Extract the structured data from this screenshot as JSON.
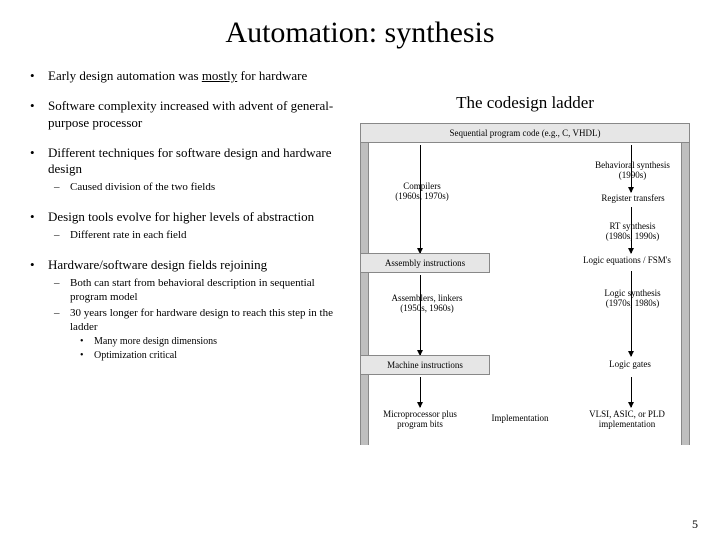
{
  "title": "Automation: synthesis",
  "bullets": {
    "b1": "Early design automation was ",
    "b1_u": "mostly",
    "b1_tail": " for hardware",
    "b2": "Software complexity increased with advent of general-purpose processor",
    "b3": "Different techniques for software design and hardware design",
    "b3_1": "Caused division of the two fields",
    "b4": "Design tools evolve for higher levels of abstraction",
    "b4_1": "Different rate in each field",
    "b5": "Hardware/software design fields rejoining",
    "b5_1": "Both can start from behavioral description in sequential program model",
    "b5_2": "30 years longer for hardware design to reach this step in the ladder",
    "b5_2_1": "Many more design dimensions",
    "b5_2_2": "Optimization critical"
  },
  "right_title": "The codesign ladder",
  "ladder": {
    "top": "Sequential program code (e.g., C, VHDL)",
    "left_compilers": "Compilers\n(1960s, 1970s)",
    "left_assemblers": "Assemblers, linkers\n(1950s, 1960s)",
    "rung_asm_instr": "Assembly instructions",
    "rung_mach_instr": "Machine instructions",
    "bottom_left": "Microprocessor plus program bits",
    "right_behav": "Behavioral synthesis\n(1990s)",
    "right_regxfer": "Register transfers",
    "right_rtsyn": "RT synthesis\n(1980s, 1990s)",
    "right_logic_eq": "Logic equations / FSM's",
    "right_logic_syn": "Logic synthesis\n(1970s, 1980s)",
    "right_logic_gates": "Logic gates",
    "bottom_mid": "Implementation",
    "bottom_right": "VLSI, ASIC, or PLD implementation"
  },
  "page": "5"
}
